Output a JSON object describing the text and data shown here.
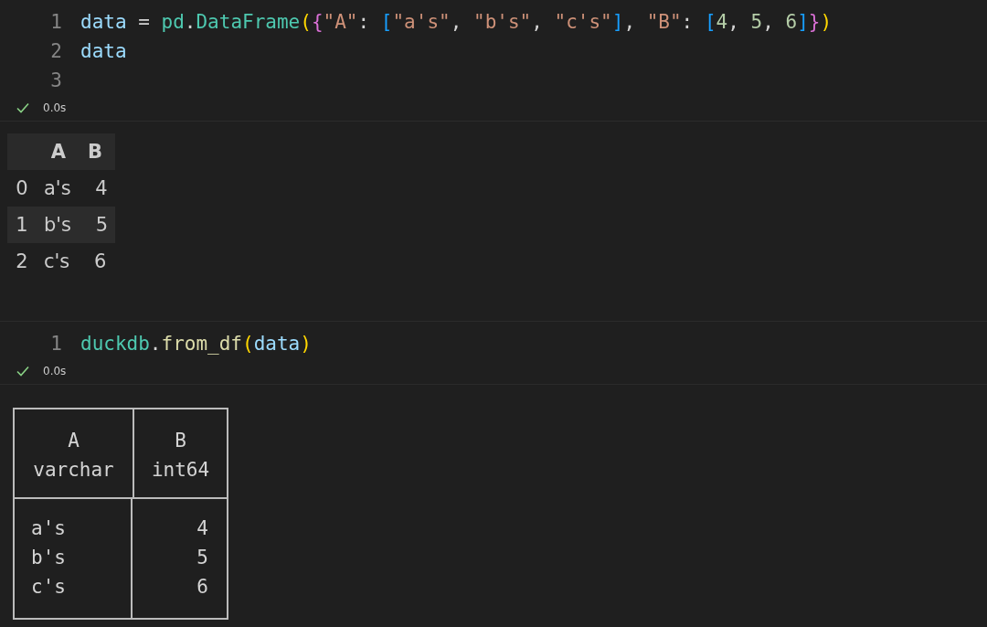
{
  "cells": [
    {
      "kind": "code",
      "lines": [
        {
          "number": "1",
          "tokens": [
            {
              "text": "data",
              "kind": "variable"
            },
            {
              "text": " = ",
              "kind": "operator"
            },
            {
              "text": "pd",
              "kind": "module"
            },
            {
              "text": ".",
              "kind": "operator"
            },
            {
              "text": "DataFrame",
              "kind": "module"
            },
            {
              "text": "(",
              "kind": "bracket1"
            },
            {
              "text": "{",
              "kind": "bracket2"
            },
            {
              "text": "\"A\"",
              "kind": "string"
            },
            {
              "text": ": ",
              "kind": "operator"
            },
            {
              "text": "[",
              "kind": "bracket3"
            },
            {
              "text": "\"a's\"",
              "kind": "string"
            },
            {
              "text": ", ",
              "kind": "operator"
            },
            {
              "text": "\"b's\"",
              "kind": "string"
            },
            {
              "text": ", ",
              "kind": "operator"
            },
            {
              "text": "\"c's\"",
              "kind": "string"
            },
            {
              "text": "]",
              "kind": "bracket3"
            },
            {
              "text": ", ",
              "kind": "operator"
            },
            {
              "text": "\"B\"",
              "kind": "string"
            },
            {
              "text": ": ",
              "kind": "operator"
            },
            {
              "text": "[",
              "kind": "bracket3"
            },
            {
              "text": "4",
              "kind": "number"
            },
            {
              "text": ", ",
              "kind": "operator"
            },
            {
              "text": "5",
              "kind": "number"
            },
            {
              "text": ", ",
              "kind": "operator"
            },
            {
              "text": "6",
              "kind": "number"
            },
            {
              "text": "]",
              "kind": "bracket3"
            },
            {
              "text": "}",
              "kind": "bracket2"
            },
            {
              "text": ")",
              "kind": "bracket1"
            }
          ]
        },
        {
          "number": "2",
          "tokens": [
            {
              "text": "data",
              "kind": "variable"
            }
          ]
        },
        {
          "number": "3"
        }
      ],
      "status": {
        "ok": true,
        "time": "0.0s"
      },
      "output": {
        "kind": "html_table",
        "columns": [
          "A",
          "B"
        ],
        "rows": [
          {
            "index": "0",
            "cells": [
              "a's",
              "4"
            ],
            "shaded": false
          },
          {
            "index": "1",
            "cells": [
              "b's",
              "5"
            ],
            "shaded": true
          },
          {
            "index": "2",
            "cells": [
              "c's",
              "6"
            ],
            "shaded": false
          }
        ]
      }
    },
    {
      "kind": "code",
      "lines": [
        {
          "number": "1",
          "tokens": [
            {
              "text": "duckdb",
              "kind": "module"
            },
            {
              "text": ".",
              "kind": "operator"
            },
            {
              "text": "from_df",
              "kind": "function"
            },
            {
              "text": "(",
              "kind": "bracket1"
            },
            {
              "text": "data",
              "kind": "variable"
            },
            {
              "text": ")",
              "kind": "bracket1"
            }
          ]
        }
      ],
      "status": {
        "ok": true,
        "time": "0.0s"
      },
      "output": {
        "kind": "box_table",
        "columns": [
          {
            "name": "A",
            "type": "varchar"
          },
          {
            "name": "B",
            "type": "int64"
          }
        ],
        "rows": [
          [
            "a's",
            "4"
          ],
          [
            "b's",
            "5"
          ],
          [
            "c's",
            "6"
          ]
        ]
      }
    }
  ]
}
